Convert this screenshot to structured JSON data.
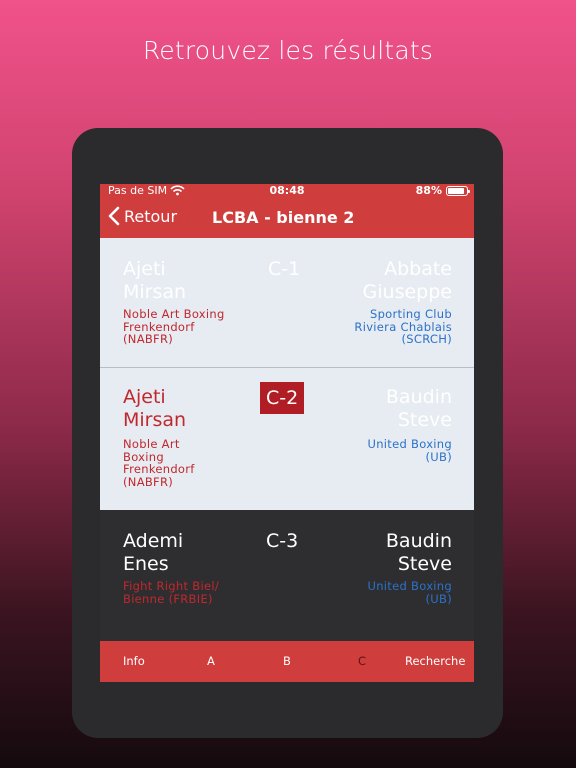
{
  "headline": "Retrouvez les résultats",
  "status": {
    "carrier": "Pas de SIM",
    "time": "08:48",
    "battery": "88%",
    "battery_level": 0.88
  },
  "nav": {
    "back_label": "Retour",
    "title": "LCBA - bienne 2"
  },
  "fights": [
    {
      "code": "C-1",
      "left": {
        "name1": "Ajeti",
        "name2": "Mirsan",
        "club": [
          "Noble Art Boxing",
          "Frenkendorf",
          "(NABFR)"
        ]
      },
      "right": {
        "name1": "Abbate",
        "name2": "Giuseppe",
        "club": [
          "Sporting Club",
          "Riviera Chablais",
          "(SCRCH)"
        ]
      }
    },
    {
      "code": "C-2",
      "left": {
        "name1": "Ajeti",
        "name2": "Mirsan",
        "club": [
          "Noble Art",
          "Boxing",
          "Frenkendorf",
          "(NABFR)"
        ]
      },
      "right": {
        "name1": "Baudin",
        "name2": "Steve",
        "club": [
          "United Boxing",
          "(UB)"
        ]
      }
    },
    {
      "code": "C-3",
      "left": {
        "name1": "Ademi",
        "name2": "Enes",
        "club": [
          "Fight Right Biel/",
          "Bienne (FRBIE)"
        ]
      },
      "right": {
        "name1": "Baudin",
        "name2": "Steve",
        "club": [
          "United Boxing",
          "(UB)"
        ]
      }
    }
  ],
  "tabs": [
    "Info",
    "A",
    "B",
    "C",
    "Recherche"
  ],
  "active_tab": "C"
}
